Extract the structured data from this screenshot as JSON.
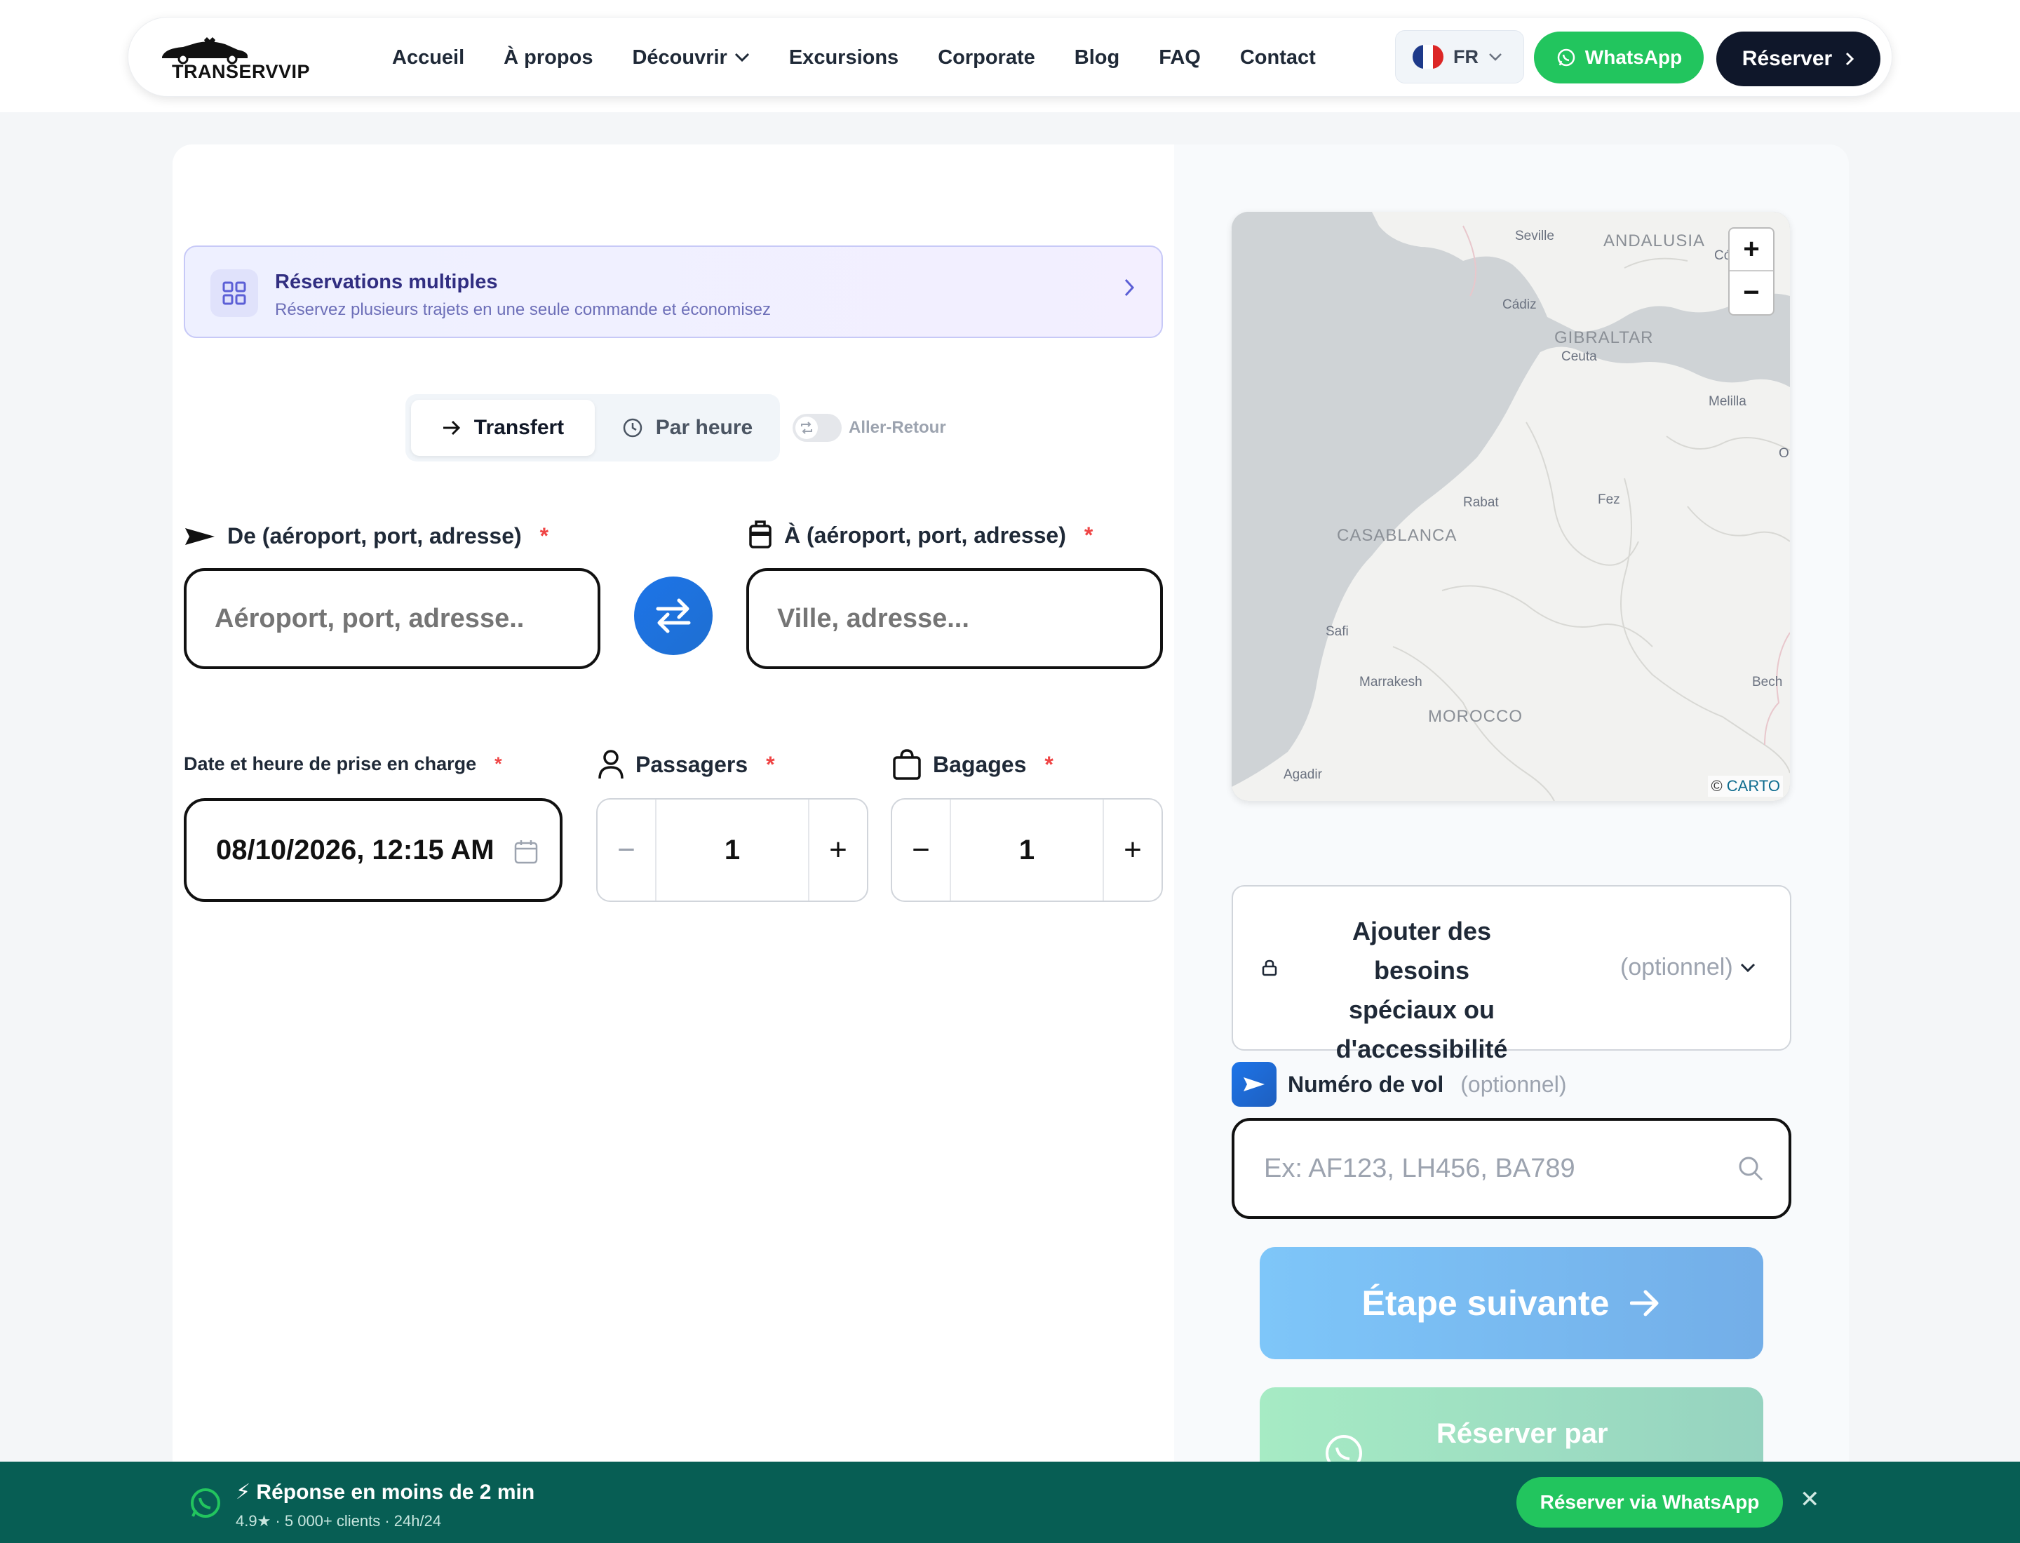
{
  "header": {
    "logo_text": "TRANSERVVIP",
    "nav": [
      "Accueil",
      "À propos",
      "Découvrir",
      "Excursions",
      "Corporate",
      "Blog",
      "FAQ",
      "Contact"
    ],
    "language": "FR",
    "whatsapp_label": "WhatsApp",
    "reserve_label": "Réserver"
  },
  "multi_booking": {
    "title": "Réservations multiples",
    "subtitle": "Réservez plusieurs trajets en une seule commande et économisez"
  },
  "mode": {
    "transfer_label": "Transfert",
    "hourly_label": "Par heure",
    "round_trip_label": "Aller-Retour",
    "round_trip_enabled": false
  },
  "from": {
    "label": "De (aéroport, port, adresse)",
    "required": "*",
    "placeholder": "Aéroport, port, adresse.."
  },
  "to": {
    "label": "À (aéroport, port, adresse)",
    "required": "*",
    "placeholder": "Ville, adresse..."
  },
  "pickup": {
    "label": "Date et heure de prise en charge",
    "required": "*",
    "value": "08/10/2026, 12:15 AM"
  },
  "passengers": {
    "label": "Passagers",
    "required": "*",
    "minus": "−",
    "value": "1",
    "plus": "+"
  },
  "luggage": {
    "label": "Bagages",
    "required": "*",
    "minus": "−",
    "value": "1",
    "plus": "+"
  },
  "map": {
    "labels": {
      "seville": "Seville",
      "andalusia": "ANDALUSIA",
      "cordoba": "Córdoba",
      "cadiz": "Cádiz",
      "gibraltar": "GIBRALTAR",
      "ceuta": "Ceuta",
      "melilla": "Melilla",
      "oujda": "O",
      "rabat": "Rabat",
      "fez": "Fez",
      "casablanca": "CASABLANCA",
      "safi": "Safi",
      "marrakesh": "Marrakesh",
      "morocco": "MOROCCO",
      "bechar": "Bech",
      "agadir": "Agadir"
    },
    "zoom_in": "+",
    "zoom_out": "−",
    "attribution_prefix": "©",
    "attribution_link": "CARTO"
  },
  "special_needs": {
    "label": "Ajouter des besoins spéciaux ou d'accessibilité",
    "optional": "(optionnel)"
  },
  "flight": {
    "label": "Numéro de vol",
    "optional": "(optionnel)",
    "placeholder": "Ex: AF123, LH456, BA789"
  },
  "actions": {
    "next_label": "Étape suivante",
    "whatsapp_book_label": "Réserver par"
  },
  "bottom_bar": {
    "title": "⚡ Réponse en moins de 2 min",
    "subtitle": "4.9★ · 5 000+ clients · 24h/24",
    "button": "Réserver via WhatsApp",
    "close": "✕"
  },
  "colors": {
    "brand_dark": "#0f172a",
    "whatsapp": "#22c55e",
    "whatsapp_dark": "#075e54",
    "accent_blue": "#1d74e8",
    "required": "#ef4444"
  }
}
